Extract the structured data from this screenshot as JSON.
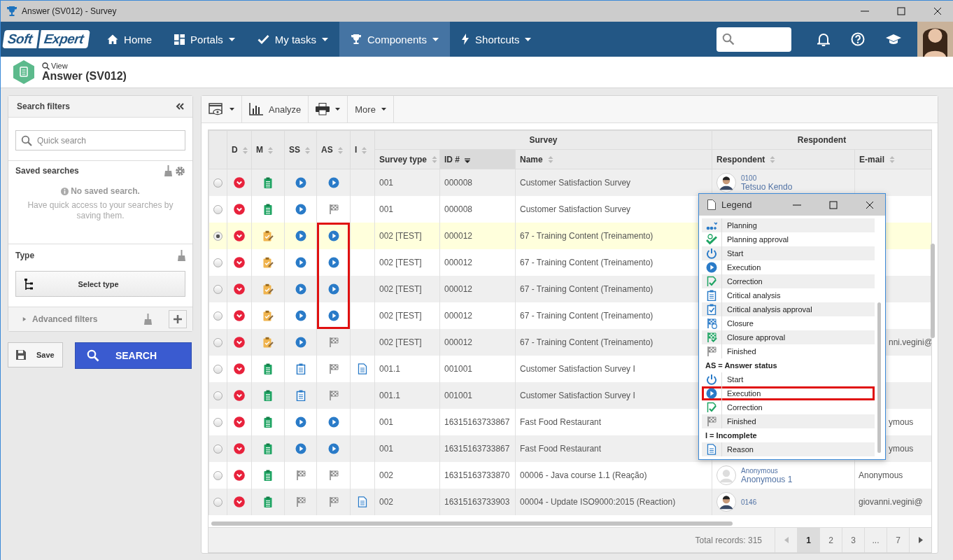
{
  "window": {
    "title": "Answer (SV012) - Survey"
  },
  "nav": {
    "logo": [
      "Soft",
      "Expert"
    ],
    "items": [
      {
        "label": "Home",
        "kind": "home",
        "dropdown": false,
        "selected": false
      },
      {
        "label": "Portals",
        "kind": "grid",
        "dropdown": true,
        "selected": false
      },
      {
        "label": "My tasks",
        "kind": "check",
        "dropdown": true,
        "selected": false
      },
      {
        "label": "Components",
        "kind": "trophy",
        "dropdown": true,
        "selected": true
      },
      {
        "label": "Shortcuts",
        "kind": "bolt",
        "dropdown": true,
        "selected": false
      }
    ]
  },
  "page": {
    "breadcrumb": "View",
    "title": "Answer (SV012)"
  },
  "filters": {
    "title": "Search filters",
    "quick_search": {
      "placeholder": "Quick search"
    },
    "saved": {
      "title": "Saved searches",
      "empty_title": "No saved search.",
      "empty_text": "Have quick access to your searches by saving them."
    },
    "type": {
      "title": "Type",
      "button": "Select type"
    },
    "advanced": {
      "label": "Advanced filters",
      "expanded": false
    }
  },
  "actions": {
    "save": "Save",
    "search": "SEARCH"
  },
  "toolbar": {
    "analyze": "Analyze",
    "more": "More"
  },
  "table": {
    "groups": [
      "Survey",
      "Respondent"
    ],
    "status_columns": [
      "D",
      "M",
      "SS",
      "AS",
      "I"
    ],
    "columns": [
      {
        "label": "Survey type",
        "sorted": false
      },
      {
        "label": "ID #",
        "sorted": true
      },
      {
        "label": "Name",
        "sorted": false
      },
      {
        "label": "Respondent",
        "sorted": false
      },
      {
        "label": "E-mail",
        "sorted": false
      }
    ],
    "rows": [
      {
        "selected": false,
        "icons": [
          {
            "kind": "dropdown"
          },
          {
            "kind": "survey"
          },
          {
            "kind": "execution"
          },
          {
            "kind": "execution",
            "highlighted": false
          }
        ],
        "incomplete": false,
        "covered": false,
        "type": "001",
        "id": "000008",
        "name": "Customer Satisfaction Survey",
        "respondent": {
          "code": "0100",
          "name": "Tetsuo Kendo",
          "kind": "photo"
        }
      },
      {
        "selected": false,
        "icons": [
          {
            "kind": "dropdown"
          },
          {
            "kind": "survey"
          },
          {
            "kind": "execution"
          },
          {
            "kind": "finished",
            "highlighted": false
          }
        ],
        "incomplete": false,
        "covered": false,
        "type": "001",
        "id": "000008",
        "name": "Customer Satisfaction Survey"
      },
      {
        "selected": true,
        "icons": [
          {
            "kind": "dropdown"
          },
          {
            "kind": "edit"
          },
          {
            "kind": "execution"
          },
          {
            "kind": "execution",
            "highlighted": true
          }
        ],
        "incomplete": false,
        "covered": false,
        "type": "002 [TEST]",
        "id": "000012",
        "name": "67 - Training Content (Treinamento)"
      },
      {
        "selected": false,
        "icons": [
          {
            "kind": "dropdown"
          },
          {
            "kind": "edit"
          },
          {
            "kind": "execution"
          },
          {
            "kind": "execution",
            "highlighted": true
          }
        ],
        "incomplete": false,
        "covered": false,
        "type": "002 [TEST]",
        "id": "000012",
        "name": "67 - Training Content (Treinamento)"
      },
      {
        "selected": false,
        "icons": [
          {
            "kind": "dropdown"
          },
          {
            "kind": "edit"
          },
          {
            "kind": "execution"
          },
          {
            "kind": "execution",
            "highlighted": true
          }
        ],
        "incomplete": false,
        "covered": false,
        "type": "002 [TEST]",
        "id": "000012",
        "name": "67 - Training Content (Treinamento)"
      },
      {
        "selected": false,
        "icons": [
          {
            "kind": "dropdown"
          },
          {
            "kind": "edit"
          },
          {
            "kind": "execution"
          },
          {
            "kind": "execution",
            "highlighted": true
          }
        ],
        "incomplete": false,
        "covered": false,
        "type": "002 [TEST]",
        "id": "000012",
        "name": "67 - Training Content (Treinamento)"
      },
      {
        "selected": false,
        "icons": [
          {
            "kind": "dropdown"
          },
          {
            "kind": "edit"
          },
          {
            "kind": "execution"
          },
          {
            "kind": "finished",
            "highlighted": false
          }
        ],
        "incomplete": false,
        "covered": true,
        "type": "002 [TEST]",
        "id": "000012",
        "name": "67 - Training Content (Treinamento)",
        "email": "nni.vegini@"
      },
      {
        "selected": false,
        "icons": [
          {
            "kind": "dropdown"
          },
          {
            "kind": "survey"
          },
          {
            "kind": "critical_analysis"
          },
          {
            "kind": "finished",
            "highlighted": false
          }
        ],
        "incomplete": true,
        "covered": false,
        "type": "001.1",
        "id": "001001",
        "name": "Customer Satisfaction Survey I"
      },
      {
        "selected": false,
        "icons": [
          {
            "kind": "dropdown"
          },
          {
            "kind": "survey"
          },
          {
            "kind": "critical_analysis"
          },
          {
            "kind": "finished",
            "highlighted": false
          }
        ],
        "incomplete": false,
        "covered": false,
        "type": "001.1",
        "id": "001001",
        "name": "Customer Satisfaction Survey I"
      },
      {
        "selected": false,
        "icons": [
          {
            "kind": "dropdown"
          },
          {
            "kind": "survey"
          },
          {
            "kind": "execution"
          },
          {
            "kind": "execution",
            "highlighted": false
          }
        ],
        "incomplete": false,
        "covered": true,
        "type": "001",
        "id": "16315163733867",
        "name": "Fast Food Restaurant",
        "email": "ymous"
      },
      {
        "selected": false,
        "icons": [
          {
            "kind": "dropdown"
          },
          {
            "kind": "survey"
          },
          {
            "kind": "execution"
          },
          {
            "kind": "execution",
            "highlighted": false
          }
        ],
        "incomplete": false,
        "covered": true,
        "type": "001",
        "id": "16315163733867",
        "name": "Fast Food Restaurant",
        "email": "ymous"
      },
      {
        "selected": false,
        "icons": [
          {
            "kind": "dropdown"
          },
          {
            "kind": "survey"
          },
          {
            "kind": "finished"
          },
          {
            "kind": "finished",
            "highlighted": false
          }
        ],
        "incomplete": false,
        "covered": false,
        "type": "002",
        "id": "16315163733870",
        "name": "00006 - Java course 1.1 (Reação)",
        "respondent": {
          "code": "Anonymous",
          "name": "Anonymous 1",
          "kind": "anonymous"
        },
        "email": "Anonymous"
      },
      {
        "selected": false,
        "icons": [
          {
            "kind": "dropdown"
          },
          {
            "kind": "survey"
          },
          {
            "kind": "finished"
          },
          {
            "kind": "finished",
            "highlighted": false
          }
        ],
        "incomplete": true,
        "covered": false,
        "type": "002",
        "id": "16315163733903",
        "name": "00004 - Update ISO9000:2015 (Reaction)",
        "respondent": {
          "code": "0146",
          "kind": "photo"
        },
        "email": "giovanni.vegini@"
      }
    ]
  },
  "footer": {
    "total": "Total records: 315",
    "pages": [
      {
        "label": "1",
        "selected": true
      },
      {
        "label": "2",
        "selected": false
      },
      {
        "label": "3",
        "selected": false
      },
      {
        "label": "...",
        "selected": false
      },
      {
        "label": "7",
        "selected": false
      }
    ]
  },
  "legend": {
    "title": "Legend",
    "sections": [
      {
        "items": [
          {
            "label": "Planning",
            "kind": "planning",
            "highlighted": false
          },
          {
            "label": "Planning approval",
            "kind": "planning_approval",
            "highlighted": false
          },
          {
            "label": "Start",
            "kind": "start",
            "highlighted": false
          },
          {
            "label": "Execution",
            "kind": "execution",
            "highlighted": false
          },
          {
            "label": "Correction",
            "kind": "correction",
            "highlighted": false
          },
          {
            "label": "Critical analysis",
            "kind": "critical_analysis",
            "highlighted": false
          },
          {
            "label": "Critical analysis approval",
            "kind": "critical_analysis_approval",
            "highlighted": false
          },
          {
            "label": "Closure",
            "kind": "closure",
            "highlighted": false
          },
          {
            "label": "Closure approval",
            "kind": "closure_approval",
            "highlighted": false
          },
          {
            "label": "Finished",
            "kind": "finished",
            "highlighted": false
          }
        ]
      },
      {
        "heading": "AS = Answer status",
        "items": [
          {
            "label": "Start",
            "kind": "start",
            "highlighted": false
          },
          {
            "label": "Execution",
            "kind": "execution",
            "highlighted": true
          },
          {
            "label": "Correction",
            "kind": "correction",
            "highlighted": false
          },
          {
            "label": "Finished",
            "kind": "finished",
            "highlighted": false
          }
        ]
      },
      {
        "heading": "I = Incomplete",
        "items": [
          {
            "label": "Reason",
            "kind": "reason",
            "highlighted": false
          }
        ]
      }
    ]
  }
}
